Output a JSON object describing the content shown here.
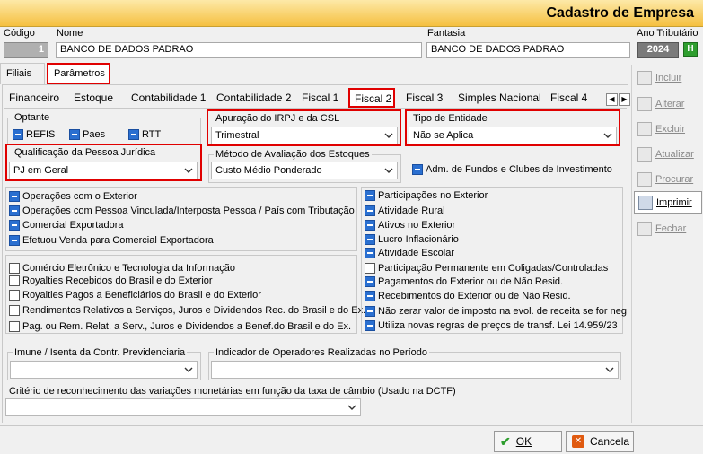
{
  "window": {
    "title": "Cadastro de Empresa"
  },
  "header": {
    "codigo_label": "Código",
    "codigo_value": "1",
    "nome_label": "Nome",
    "nome_value": "BANCO DE DADOS PADRAO",
    "fantasia_label": "Fantasia",
    "fantasia_value": "BANCO DE DADOS PADRAO",
    "ano_label": "Ano Tributário",
    "ano_value": "2024",
    "ano_btn": "H"
  },
  "outer_tabs": [
    "Filiais",
    "Parâmetros"
  ],
  "inner_tabs": [
    "Financeiro",
    "Estoque",
    "Contabilidade 1",
    "Contabilidade 2",
    "Fiscal 1",
    "Fiscal 2",
    "Fiscal 3",
    "Simples Nacional",
    "Fiscal 4"
  ],
  "optante": {
    "label": "Optante",
    "items": [
      {
        "label": "REFIS",
        "checked": true
      },
      {
        "label": "Paes",
        "checked": true
      },
      {
        "label": "RTT",
        "checked": true
      }
    ]
  },
  "apuracao": {
    "label": "Apuração do IRPJ e da CSL",
    "value": "Trimestral"
  },
  "tipo_entidade": {
    "label": "Tipo de Entidade",
    "value": "Não se Aplica"
  },
  "qualificacao": {
    "label": "Qualificação da Pessoa Jurídica",
    "value": "PJ em Geral"
  },
  "metodo": {
    "label": "Método de Avaliação dos Estoques",
    "value": "Custo Médio Ponderado"
  },
  "adm_fundos": {
    "label": "Adm. de Fundos e Clubes de Investimento",
    "checked": true
  },
  "left_group1": [
    {
      "label": "Operações com o Exterior",
      "checked": true
    },
    {
      "label": "Operações com Pessoa Vinculada/Interposta Pessoa / País com Tributação",
      "checked": true
    },
    {
      "label": "Comercial Exportadora",
      "checked": true
    },
    {
      "label": "Efetuou Venda para Comercial Exportadora",
      "checked": true
    }
  ],
  "left_group2": [
    {
      "label": "Comércio Eletrônico e Tecnologia da Informação",
      "checked": false
    },
    {
      "label": "Royalties Recebidos do Brasil e do Exterior",
      "checked": false
    },
    {
      "label": "Royalties Pagos a Beneficiários do Brasil e do Exterior",
      "checked": false
    },
    {
      "label": "Rendimentos Relativos a Serviços, Juros e Dividendos Rec. do Brasil e do Ex.",
      "checked": false
    },
    {
      "label": "Pag. ou Rem.  Relat. a Serv., Juros e Dividendos a Benef.do Brasil e do Ex.",
      "checked": false
    }
  ],
  "right_group": [
    {
      "label": "Participações no Exterior",
      "checked": true
    },
    {
      "label": "Atividade Rural",
      "checked": true
    },
    {
      "label": "Ativos no Exterior",
      "checked": true
    },
    {
      "label": "Lucro Inflacionário",
      "checked": true
    },
    {
      "label": "Atividade Escolar",
      "checked": true
    },
    {
      "label": "Participação Permanente em Coligadas/Controladas",
      "checked": false
    },
    {
      "label": "Pagamentos do Exterior ou de Não Resid.",
      "checked": true
    },
    {
      "label": "Recebimentos do Exterior ou de Não Resid.",
      "checked": true
    },
    {
      "label": "Não zerar valor de imposto na evol. de receita se for neg",
      "checked": true
    },
    {
      "label": "Utiliza novas regras de preços de transf.  Lei 14.959/23",
      "checked": true
    }
  ],
  "imune": {
    "label": "Imune / Isenta da Contr. Previdenciaria",
    "value": ""
  },
  "indicador": {
    "label": "Indicador de Operadores Realizadas no Período",
    "value": ""
  },
  "criterio": {
    "label": "Critério de reconhecimento das variações monetárias em função da taxa de câmbio  (Usado na DCTF)",
    "value": ""
  },
  "side_buttons": [
    "Incluir",
    "Alterar",
    "Excluir",
    "Atualizar",
    "Procurar",
    "Imprimir",
    "Fechar"
  ],
  "bottom": {
    "ok": "OK",
    "cancel": "Cancela"
  },
  "colors": {
    "accent": "#2a6fd0",
    "highlight": "#e00000",
    "title_gold": "#f5c040",
    "ok_green": "#2e9e2e",
    "cancel_orange": "#e05a10"
  }
}
